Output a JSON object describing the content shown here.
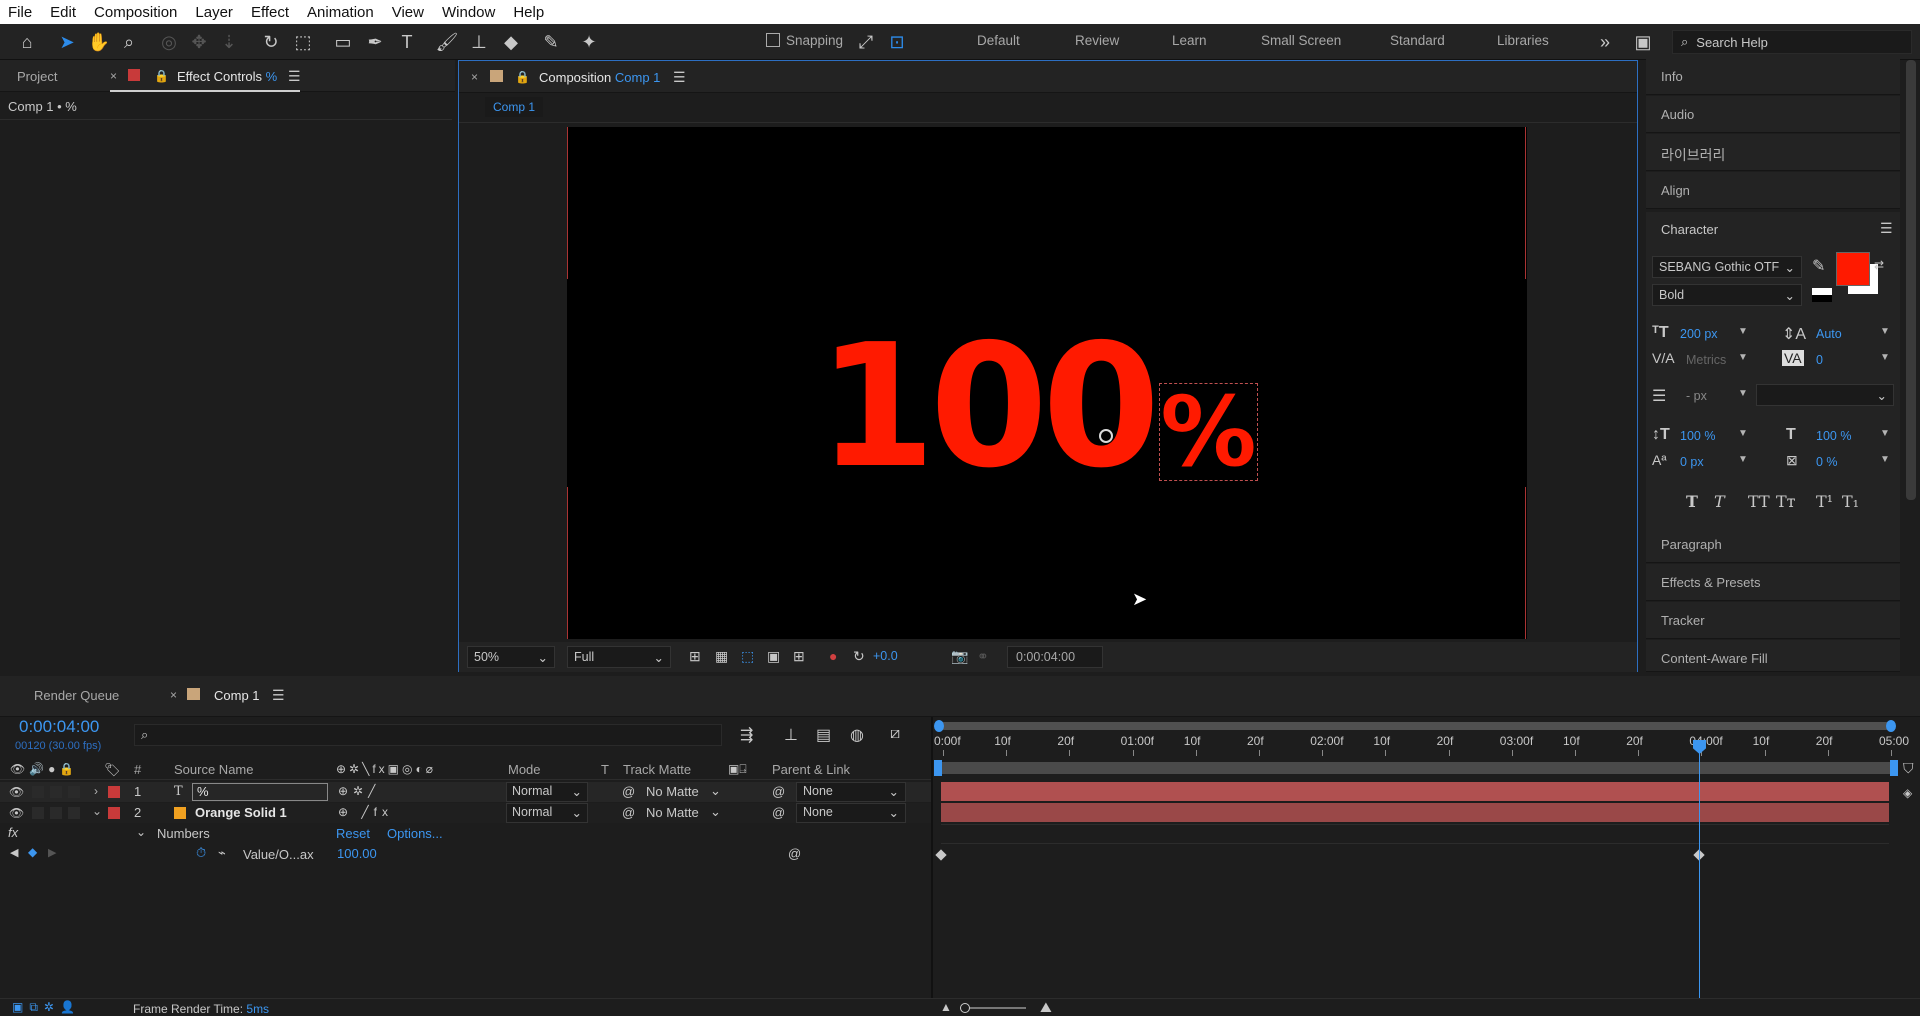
{
  "menu": [
    "File",
    "Edit",
    "Composition",
    "Layer",
    "Effect",
    "Animation",
    "View",
    "Window",
    "Help"
  ],
  "toolbar": {
    "snapping_label": "Snapping",
    "workspaces": [
      "Default",
      "Review",
      "Learn",
      "Small Screen",
      "Standard",
      "Libraries"
    ],
    "search_placeholder": "Search Help"
  },
  "left_panel": {
    "tab_project": "Project",
    "tab_effect_controls": "Effect Controls",
    "tab_effect_controls_layer": "%",
    "breadcrumb": "Comp 1 • %"
  },
  "composition": {
    "tab_label": "Composition",
    "tab_comp": "Comp 1",
    "sub_tab": "Comp 1",
    "canvas_text_main": "100",
    "canvas_text_pct": "%",
    "canvas_color": "#ff1a00",
    "zoom": "50%",
    "resolution": "Full",
    "exposure": "+0.0",
    "timecode": "0:00:04:00"
  },
  "right_panel": {
    "items_top": [
      "Info",
      "Audio",
      "라이브러리",
      "Align"
    ],
    "character_title": "Character",
    "font_family": "SEBANG Gothic OTF",
    "font_style": "Bold",
    "fill_color": "#ff1a00",
    "font_size": "200 px",
    "leading": "Auto",
    "kerning": "Metrics",
    "tracking": "0",
    "stroke_width": "- px",
    "vert_scale": "100 %",
    "horiz_scale": "100 %",
    "baseline_shift": "0 px",
    "tsume": "0 %",
    "items_bottom": [
      "Paragraph",
      "Effects & Presets",
      "Tracker",
      "Content-Aware Fill"
    ]
  },
  "timeline": {
    "tab_render_queue": "Render Queue",
    "tab_comp": "Comp 1",
    "current_time": "0:00:04:00",
    "frame_info": "00120 (30.00 fps)",
    "columns": {
      "num": "#",
      "source": "Source Name",
      "mode": "Mode",
      "t": "T",
      "track_matte": "Track Matte",
      "parent": "Parent & Link"
    },
    "layers": [
      {
        "num": "1",
        "name": "%",
        "mode": "Normal",
        "matte": "No Matte",
        "parent": "None",
        "type": "T"
      },
      {
        "num": "2",
        "name": "Orange Solid 1",
        "mode": "Normal",
        "matte": "No Matte",
        "parent": "None",
        "type": "solid"
      }
    ],
    "effect_name": "Numbers",
    "reset_label": "Reset",
    "options_label": "Options...",
    "property_name": "Value/O...ax",
    "property_value": "100.00",
    "ruler_labels": [
      "0:00f",
      "10f",
      "20f",
      "01:00f",
      "10f",
      "20f",
      "02:00f",
      "10f",
      "20f",
      "03:00f",
      "10f",
      "20f",
      "04:00f",
      "10f",
      "20f",
      "05:00"
    ],
    "footer_label": "Frame Render Time:",
    "footer_value": "5ms"
  }
}
